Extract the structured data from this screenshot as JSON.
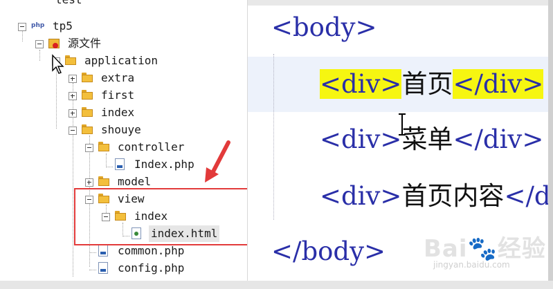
{
  "tree": {
    "partial_top": "test",
    "project": "tp5",
    "project_icon": "php",
    "source_folder": "源文件",
    "application": "application",
    "extra": "extra",
    "first": "first",
    "index_folder": "index",
    "shouye": "shouye",
    "controller": "controller",
    "index_php": "Index.php",
    "model": "model",
    "view": "view",
    "view_index": "index",
    "index_html": "index.html",
    "common_php": "common.php",
    "config_php": "config.php"
  },
  "code": {
    "body_open": "<body>",
    "line1_open": "<div>",
    "line1_text": "首页",
    "line1_close": "</div>",
    "line2_open": "<div>",
    "line2_text": "菜单",
    "line2_close": "</div>",
    "line3_open": "<div>",
    "line3_text": "首页内容",
    "line3_close": "</div>",
    "body_close": "</body>"
  },
  "watermark": {
    "brand": "Bai🐾经验",
    "url": "jingyan.baidu.com"
  },
  "colors": {
    "tag": "#2a2fa8",
    "highlight": "#f6f611",
    "annotation_red": "#e23a3a"
  }
}
